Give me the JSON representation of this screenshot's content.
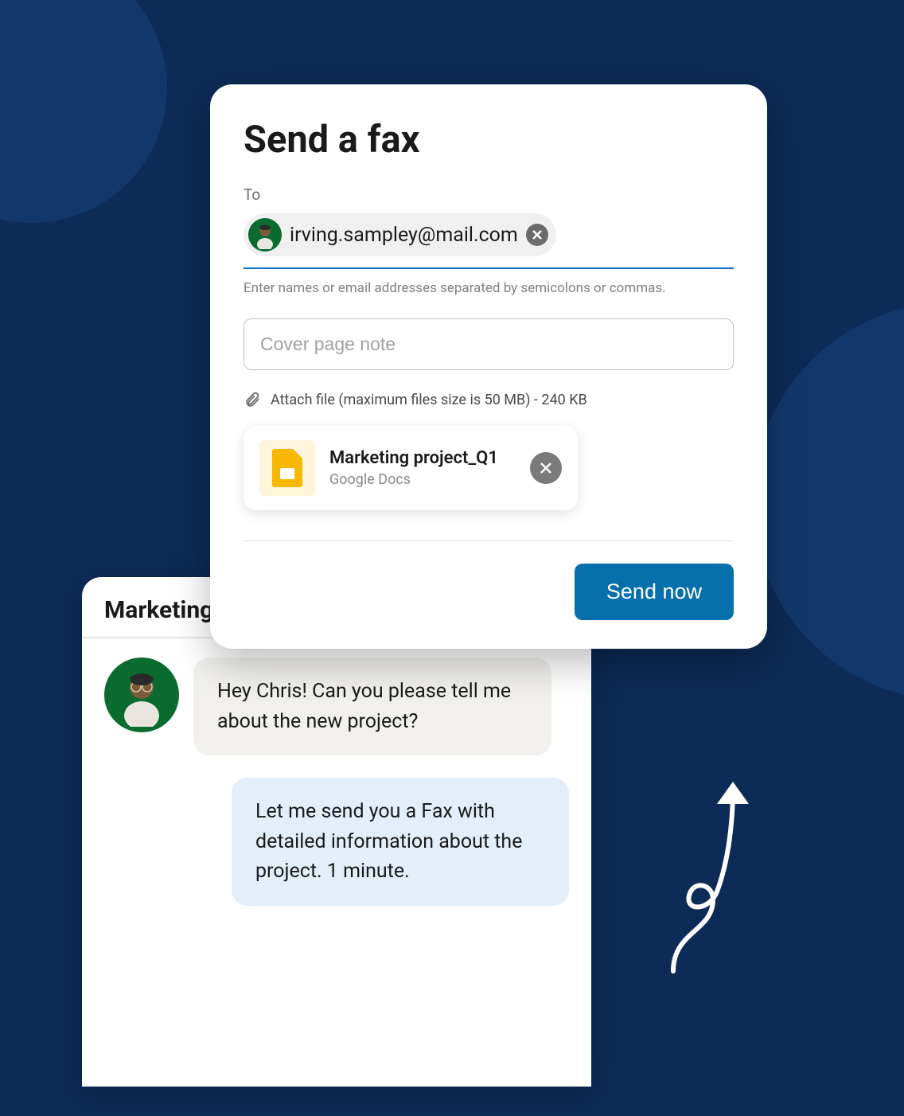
{
  "fax": {
    "title": "Send a fax",
    "to_label": "To",
    "recipient": {
      "email": "irving.sampley@mail.com"
    },
    "help_text": "Enter names or email addresses separated by semicolons or commas.",
    "cover_placeholder": "Cover page note",
    "attach_label": "Attach file (maximum files size is 50 MB) - 240 KB",
    "attachment": {
      "name": "Marketing project_Q1",
      "source": "Google Docs"
    },
    "send_button": "Send now"
  },
  "chat": {
    "title": "Marketing",
    "messages": [
      {
        "text": "Hey Chris! Can you please tell me about the new project?"
      },
      {
        "text": "Let me send you a Fax with detailed information about the project. 1 minute."
      }
    ]
  }
}
